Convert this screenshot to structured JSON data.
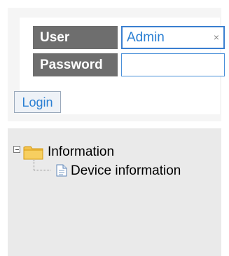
{
  "login": {
    "user_label": "User",
    "user_value": "Admin",
    "password_label": "Password",
    "password_value": "",
    "clear_glyph": "×",
    "login_button": "Login"
  },
  "tree": {
    "root": {
      "label": "Information",
      "expanded": true,
      "icon": "folder-icon"
    },
    "children": [
      {
        "label": "Device information",
        "icon": "document-icon"
      }
    ]
  },
  "colors": {
    "label_bg": "#6e6e6e",
    "accent": "#2a7fd3",
    "tree_bg": "#eaeaea",
    "panel_bg": "#f5f5f5"
  }
}
